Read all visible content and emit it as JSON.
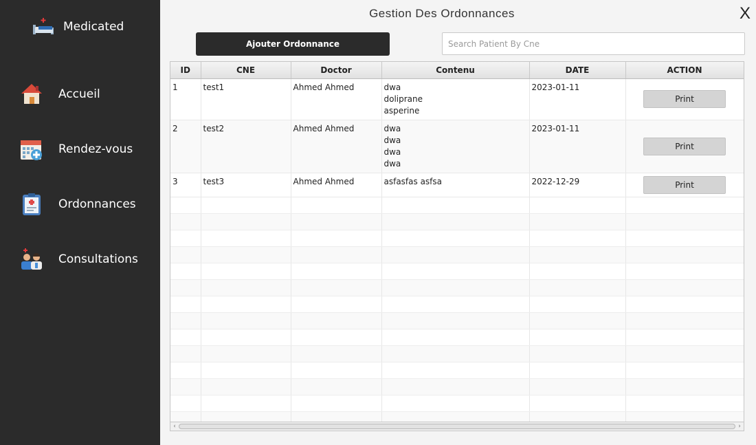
{
  "app": {
    "brand": "Medicated",
    "title": "Gestion Des Ordonnances",
    "close_label": "X"
  },
  "sidebar": {
    "items": [
      {
        "label": "Accueil",
        "icon": "house-icon"
      },
      {
        "label": "Rendez-vous",
        "icon": "calendar-icon"
      },
      {
        "label": "Ordonnances",
        "icon": "clipboard-icon"
      },
      {
        "label": "Consultations",
        "icon": "doctor-patient-icon"
      }
    ]
  },
  "toolbar": {
    "add_label": "Ajouter Ordonnance",
    "search_placeholder": "Search Patient By Cne",
    "search_value": ""
  },
  "table": {
    "columns": [
      "ID",
      "CNE",
      "Doctor",
      "Contenu",
      "DATE",
      "ACTION"
    ],
    "rows": [
      {
        "id": "1",
        "cne": "test1",
        "doctor": "Ahmed Ahmed",
        "contenu": [
          "dwa",
          "doliprane",
          "asperine"
        ],
        "date": "2023-01-11",
        "action": "Print"
      },
      {
        "id": "2",
        "cne": "test2",
        "doctor": "Ahmed Ahmed",
        "contenu": [
          "dwa",
          "dwa",
          "dwa",
          "dwa"
        ],
        "date": "2023-01-11",
        "action": "Print"
      },
      {
        "id": "3",
        "cne": "test3",
        "doctor": "Ahmed Ahmed",
        "contenu": [
          "asfasfas asfsa"
        ],
        "date": "2022-12-29",
        "action": "Print"
      }
    ]
  }
}
